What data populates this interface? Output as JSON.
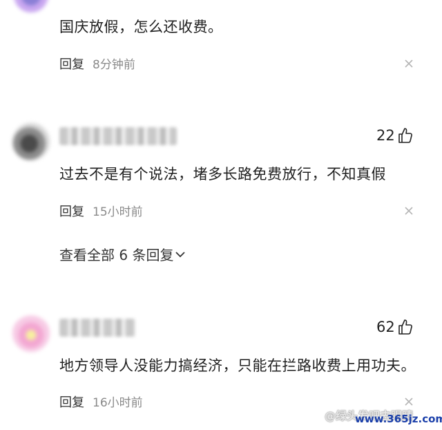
{
  "comments": [
    {
      "content": "国庆放假，怎么还收费。",
      "reply_label": "回复",
      "time": "8分钟前"
    },
    {
      "likes": "22",
      "content": "过去不是有个说法，堵多长路免费放行，不知真假",
      "reply_label": "回复",
      "time": "15小时前",
      "view_all_replies": "查看全部 6 条回复"
    },
    {
      "likes": "62",
      "content": "地方领导人没能力搞经济，只能在拦路收费上用功夫。",
      "reply_label": "回复",
      "time": "16小时前"
    }
  ],
  "watermark": {
    "text": "@绿头发吧去眼睛",
    "url": "www.365jz.com"
  },
  "icons": {
    "like": "thumbs-up-icon",
    "close": "close-icon",
    "expand": "chevron-down-icon"
  },
  "colors": {
    "text": "#1f1f1f",
    "muted": "#8a8a8a",
    "watermark_url": "#1a3faa"
  }
}
